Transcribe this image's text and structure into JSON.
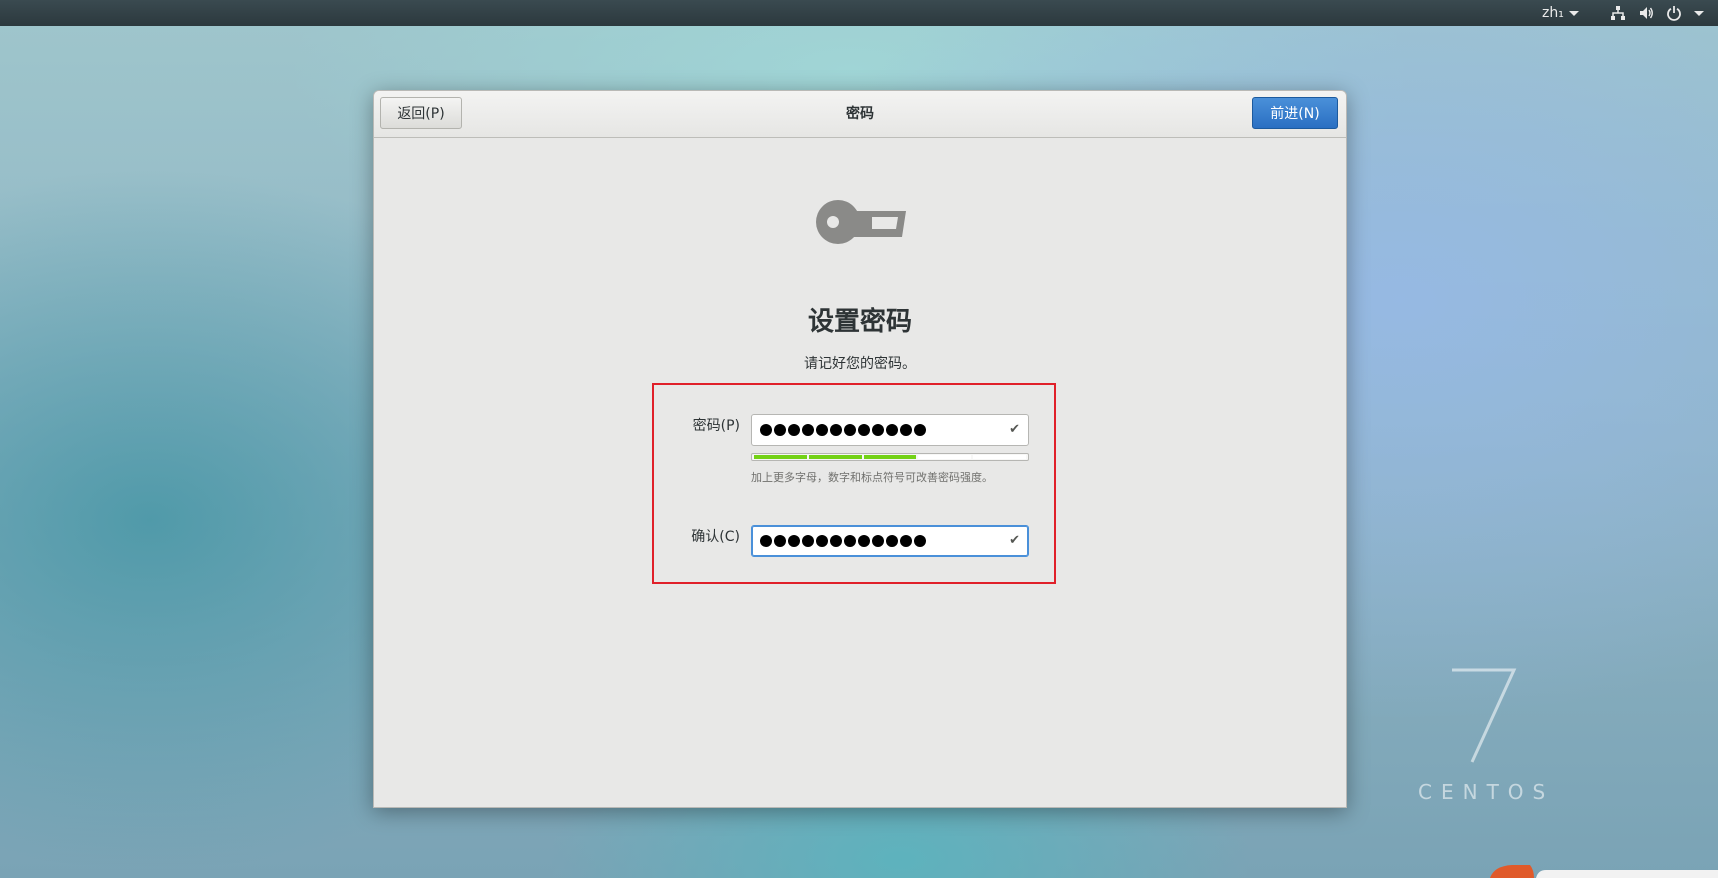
{
  "topbar": {
    "language": "zh₁",
    "icons": [
      "network-icon",
      "volume-icon",
      "power-icon"
    ]
  },
  "dialog": {
    "title": "密码",
    "back_label": "返回(P)",
    "next_label": "前进(N)",
    "icon": "key-icon",
    "heading": "设置密码",
    "subtitle": "请记好您的密码。",
    "password": {
      "label": "密码(P)",
      "masked_length": 12,
      "valid": true,
      "strength_segments_total": 5,
      "strength_segments_filled": 3,
      "hint": "加上更多字母，数字和标点符号可改善密码强度。"
    },
    "confirm": {
      "label": "确认(C)",
      "masked_length": 12,
      "valid": true,
      "focused": true
    }
  },
  "watermark": {
    "numeral": "7",
    "word": "CENTOS"
  },
  "colors": {
    "accent": "#4a90d9",
    "strength_fill": "#73d216",
    "highlight_box": "#e0202a"
  }
}
